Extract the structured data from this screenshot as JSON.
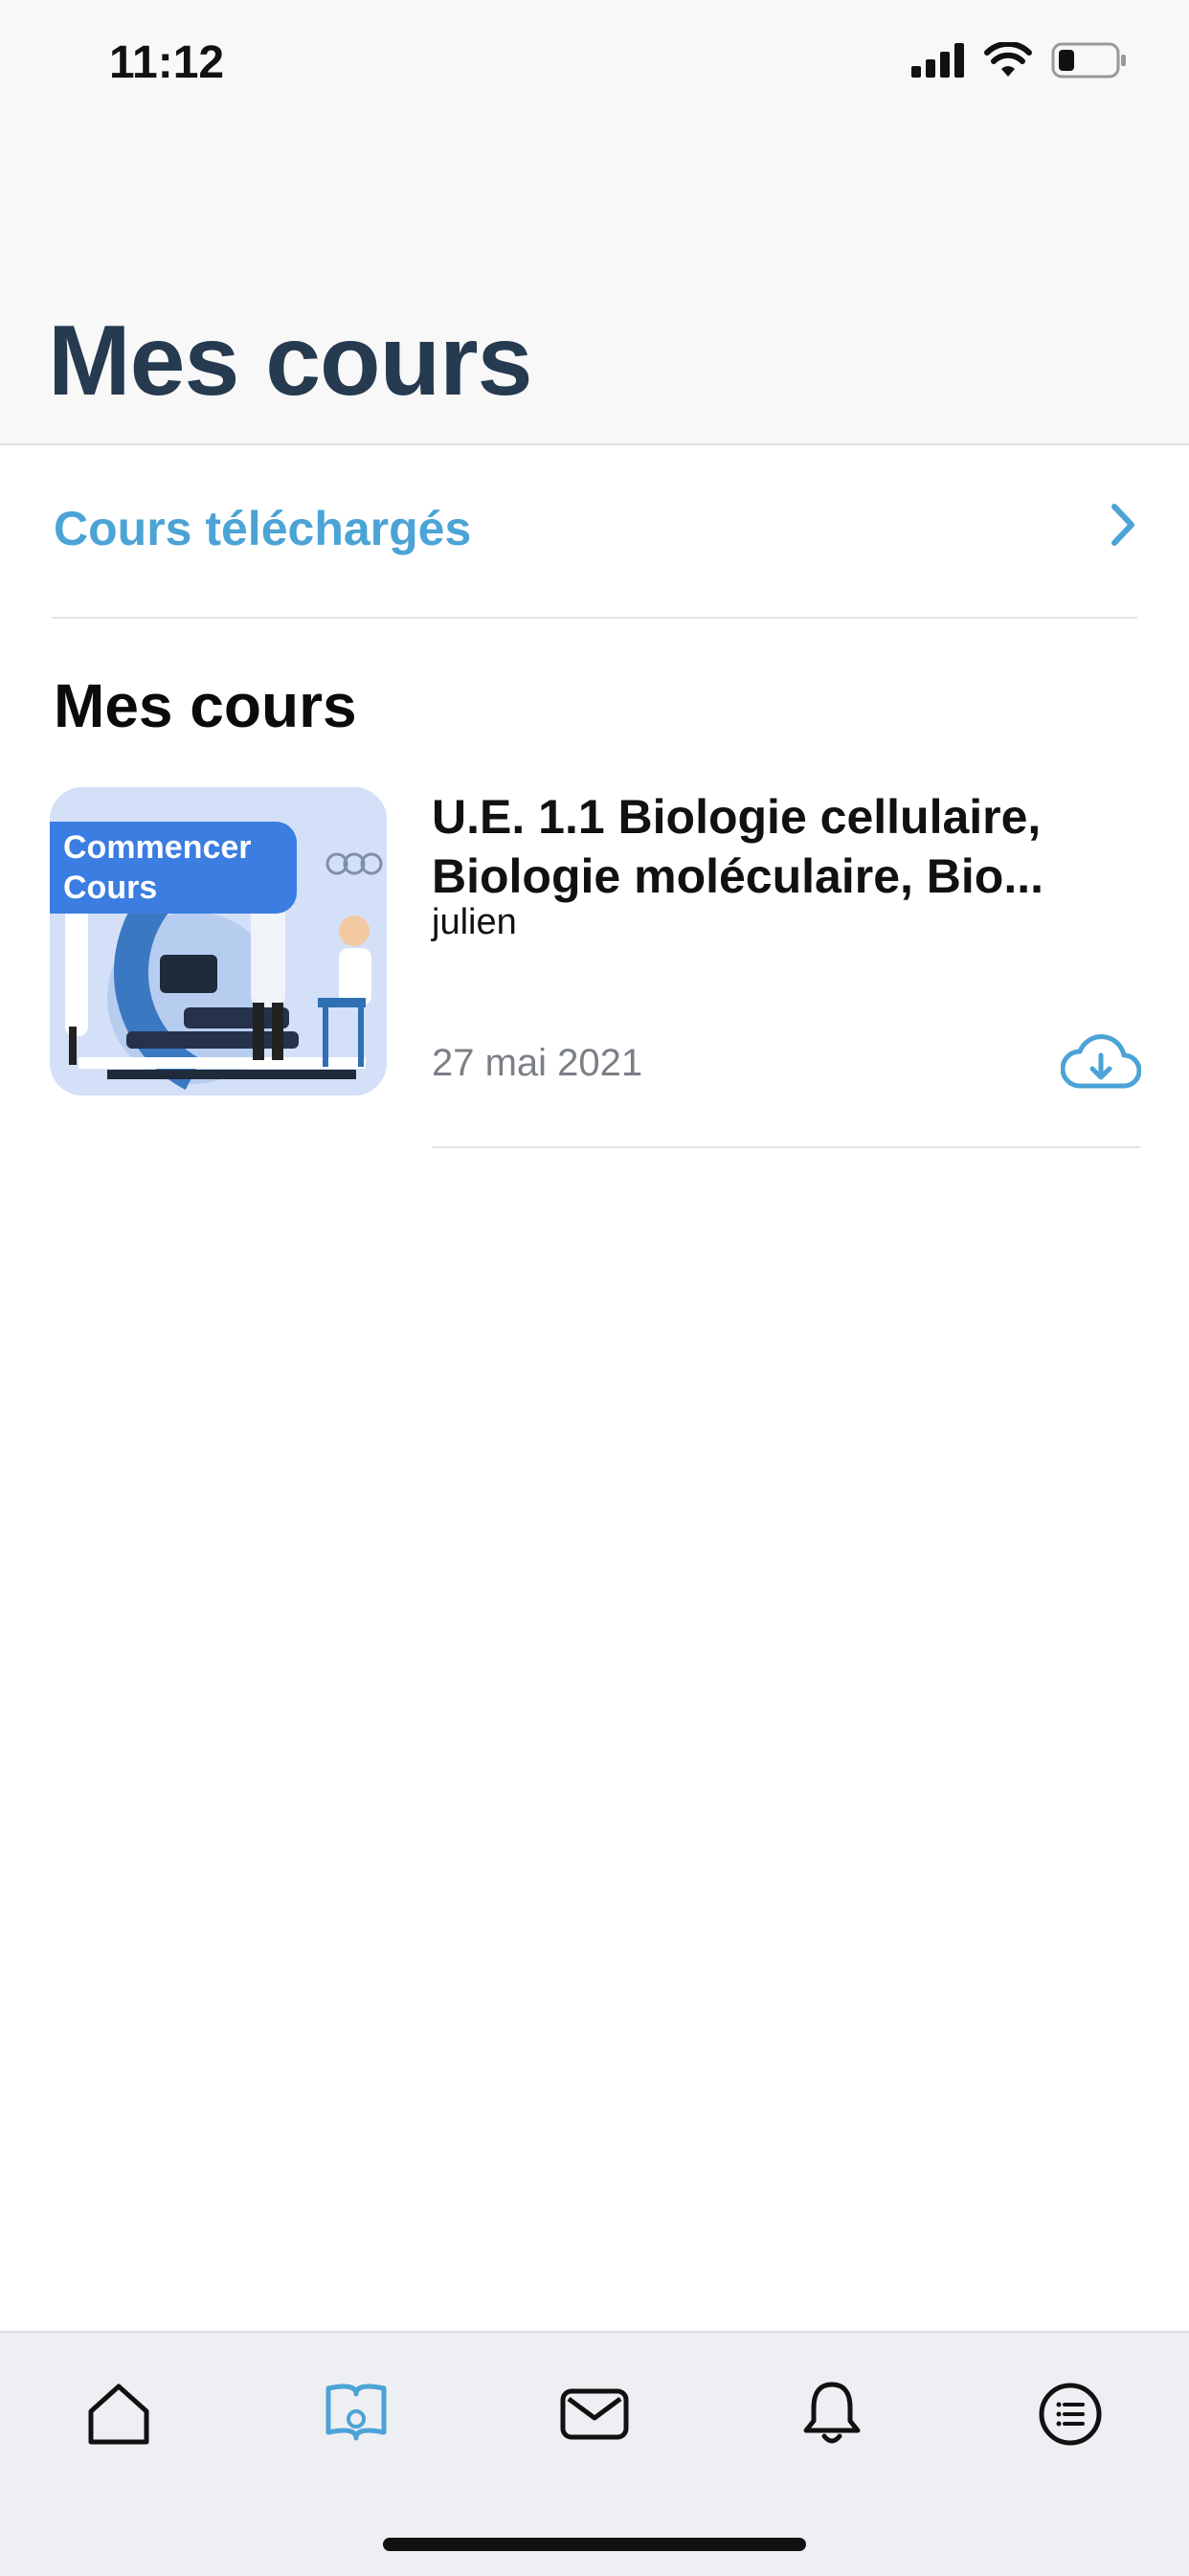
{
  "status_bar": {
    "time": "11:12"
  },
  "header": {
    "title": "Mes cours"
  },
  "downloaded_row": {
    "label": "Cours téléchargés"
  },
  "section": {
    "title": "Mes cours"
  },
  "course": {
    "badge_line1": "Commencer",
    "badge_line2": "Cours",
    "title": "U.E. 1.1 Biologie cellulaire, Biologie moléculaire, Bio...",
    "author": "julien",
    "date": "27 mai 2021"
  },
  "tabbar": {
    "items": [
      {
        "icon": "home-icon",
        "active": false
      },
      {
        "icon": "book-icon",
        "active": true
      },
      {
        "icon": "mail-icon",
        "active": false
      },
      {
        "icon": "bell-icon",
        "active": false
      },
      {
        "icon": "menu-icon",
        "active": false
      }
    ]
  },
  "colors": {
    "accent": "#4ba3d6",
    "title": "#263a50",
    "badge": "#3b7de0"
  }
}
